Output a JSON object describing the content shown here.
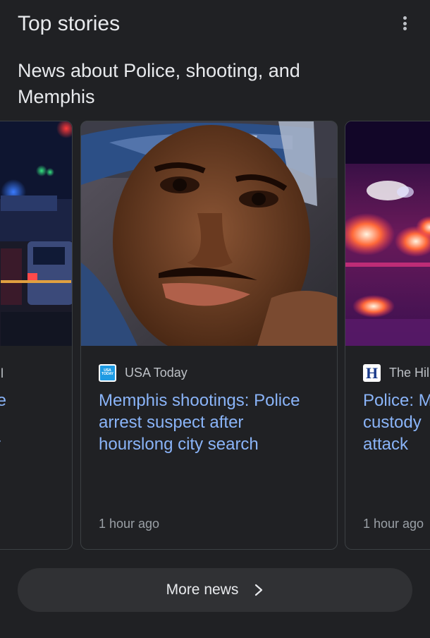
{
  "header": {
    "title": "Top stories",
    "menu_icon": "more-vert-icon"
  },
  "subheading": {
    "line1": "News about Police, shooting, and",
    "line2": "Memphis"
  },
  "cards": [
    {
      "source": "l",
      "headline_lines": [
        "lice",
        "",
        "for"
      ],
      "image": "police-lights-scene"
    },
    {
      "source": "USA Today",
      "source_logo": "usa-today-logo",
      "logo_text": "USA TODAY",
      "headline_lines": [
        "Memphis shootings: Police",
        "arrest suspect after",
        "hourslong city search"
      ],
      "time": "1 hour ago",
      "image": "portrait-man-bandana"
    },
    {
      "source": "The Hil",
      "source_logo": "the-hill-logo",
      "logo_text": "H",
      "headline_lines": [
        "Police: M",
        "custody",
        "attack"
      ],
      "time": "1 hour ago",
      "image": "police-lights-blur"
    }
  ],
  "more_news": {
    "label": "More news",
    "icon": "chevron-right-icon"
  },
  "colors": {
    "background": "#202124",
    "link": "#8ab4f8",
    "text": "#e8eaed",
    "muted": "#9aa0a6"
  }
}
